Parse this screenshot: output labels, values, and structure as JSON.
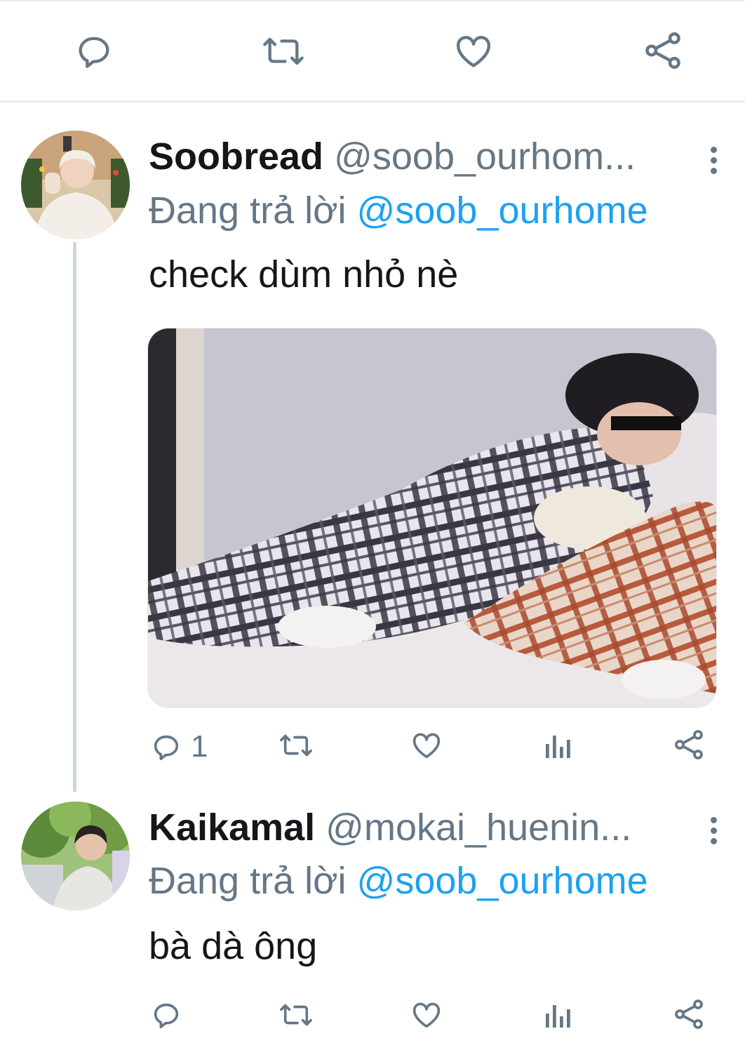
{
  "colors": {
    "accent": "#1da1f2",
    "secondary_text": "#657786",
    "divider": "#e6ecf0"
  },
  "top_actions": {
    "icons": [
      "reply-icon",
      "retweet-icon",
      "like-icon",
      "share-icon"
    ]
  },
  "tweets": [
    {
      "name": "Soobread",
      "handle": "@soob_ourhom...",
      "reply_prefix": "Đang trả lời",
      "reply_mention": "@soob_ourhome",
      "text": "check dùm nhỏ nè",
      "media": "photo",
      "actions": {
        "reply_count": "1"
      },
      "action_icons": [
        "reply-icon",
        "retweet-icon",
        "like-icon",
        "analytics-icon",
        "share-icon"
      ]
    },
    {
      "name": "Kaikamal",
      "handle": "@mokai_huenin...",
      "reply_prefix": "Đang trả lời",
      "reply_mention": "@soob_ourhome",
      "text": "bà dà ông",
      "actions": {
        "reply_count": ""
      },
      "action_icons": [
        "reply-icon",
        "retweet-icon",
        "like-icon",
        "analytics-icon",
        "share-icon"
      ]
    }
  ]
}
